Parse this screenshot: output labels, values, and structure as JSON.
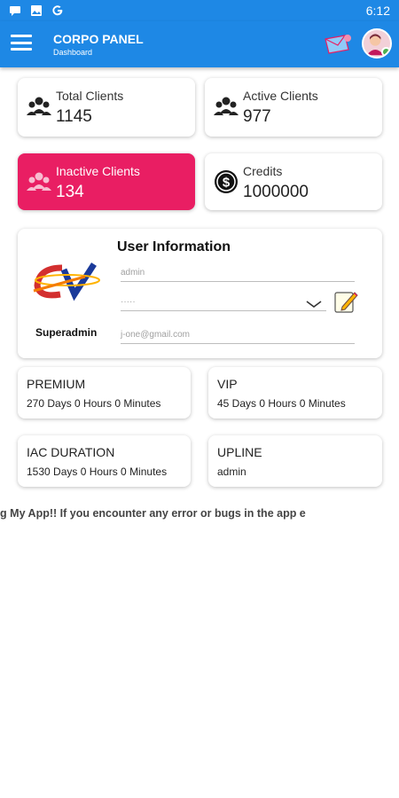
{
  "status_bar": {
    "time": "6:12",
    "icons": [
      "message-icon",
      "image-icon",
      "google-icon"
    ]
  },
  "app_bar": {
    "title": "CORPO PANEL",
    "subtitle": "Dashboard",
    "icons": [
      "menu-icon",
      "mail-icon",
      "avatar-icon"
    ]
  },
  "stats": {
    "total_clients": {
      "label": "Total Clients",
      "value": "1145"
    },
    "active_clients": {
      "label": "Active Clients",
      "value": "977"
    },
    "inactive_clients": {
      "label": "Inactive Clients",
      "value": "134"
    },
    "credits": {
      "label": "Credits",
      "value": "1000000"
    }
  },
  "user_info": {
    "title": "User Information",
    "role": "Superadmin",
    "username": "admin",
    "password_mask": "·····",
    "email": "j-one@gmail.com"
  },
  "details": {
    "premium": {
      "label": "PREMIUM",
      "value": "270 Days 0 Hours 0 Minutes"
    },
    "vip": {
      "label": "VIP",
      "value": "45 Days 0 Hours 0 Minutes"
    },
    "iac_duration": {
      "label": "IAC DURATION",
      "value": "1530 Days 0 Hours 0 Minutes"
    },
    "upline": {
      "label": "UPLINE",
      "value": "admin"
    }
  },
  "marquee": "sing My App!! If you encounter any error or bugs in the app e",
  "colors": {
    "primary": "#1e88e5",
    "inactive_card": "#e91e63"
  }
}
